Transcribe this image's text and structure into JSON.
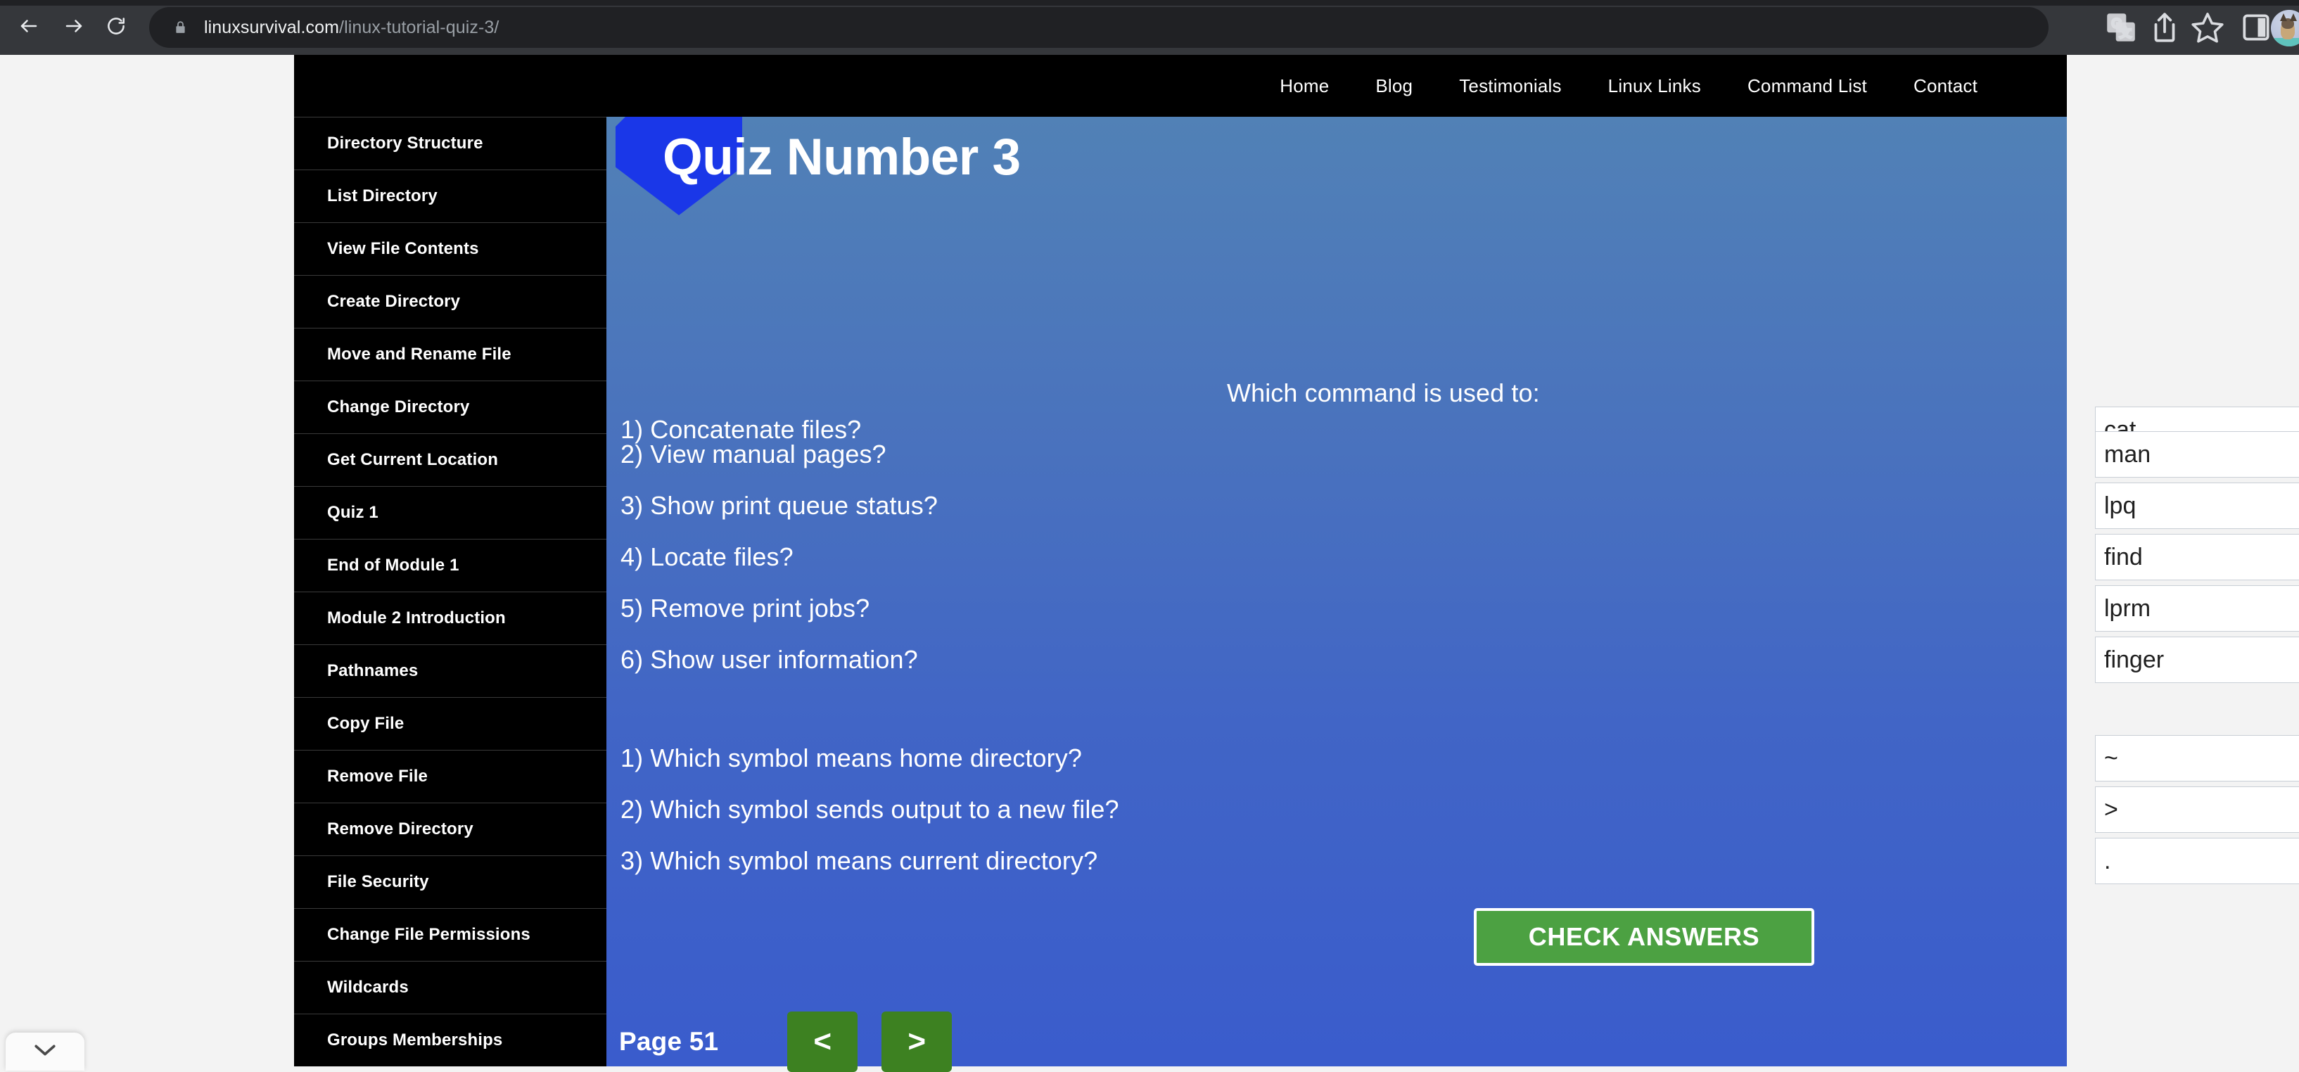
{
  "browser": {
    "back_icon": "back-arrow-icon",
    "forward_icon": "forward-arrow-icon",
    "reload_icon": "reload-icon",
    "lock_icon": "lock-icon",
    "url_domain": "linuxsurvival.com",
    "url_path": "/linux-tutorial-quiz-3/",
    "actions": [
      {
        "name": "translate-icon",
        "label": "Translate"
      },
      {
        "name": "share-icon",
        "label": "Share"
      },
      {
        "name": "bookmark-star-icon",
        "label": "Bookmark"
      },
      {
        "name": "side-panel-icon",
        "label": "Side panel"
      }
    ],
    "avatar_name": "profile-avatar",
    "downloads_chevron": "chevron-down-icon"
  },
  "site_nav": {
    "items": [
      {
        "label": "Home"
      },
      {
        "label": "Blog"
      },
      {
        "label": "Testimonials"
      },
      {
        "label": "Linux Links"
      },
      {
        "label": "Command List"
      },
      {
        "label": "Contact"
      }
    ]
  },
  "sidebar": {
    "items": [
      {
        "label": "Directory Structure"
      },
      {
        "label": "List Directory"
      },
      {
        "label": "View File Contents"
      },
      {
        "label": "Create Directory"
      },
      {
        "label": "Move and Rename File"
      },
      {
        "label": "Change Directory"
      },
      {
        "label": "Get Current Location"
      },
      {
        "label": "Quiz 1"
      },
      {
        "label": "End of Module 1"
      },
      {
        "label": "Module 2 Introduction"
      },
      {
        "label": "Pathnames"
      },
      {
        "label": "Copy File"
      },
      {
        "label": "Remove File"
      },
      {
        "label": "Remove Directory"
      },
      {
        "label": "File Security"
      },
      {
        "label": "Change File Permissions"
      },
      {
        "label": "Wildcards"
      },
      {
        "label": "Groups Memberships"
      }
    ]
  },
  "quiz": {
    "title": "Quiz Number 3",
    "prompt": "Which command is used to:",
    "section_one": [
      {
        "question": "1) Concatenate files?",
        "answer": "cat",
        "status": "correct"
      },
      {
        "question": "2) View manual pages?",
        "answer": "man",
        "status": "correct"
      },
      {
        "question": "3) Show print queue status?",
        "answer": "lpq",
        "status": "correct"
      },
      {
        "question": "4) Locate files?",
        "answer": "find",
        "status": "correct"
      },
      {
        "question": "5) Remove print jobs?",
        "answer": "lprm",
        "status": "correct"
      },
      {
        "question": "6) Show user information?",
        "answer": "finger",
        "status": "correct"
      }
    ],
    "section_two": [
      {
        "question": "1) Which symbol means home directory?",
        "answer": "~",
        "status": "correct"
      },
      {
        "question": "2) Which symbol sends output to a new file?",
        "answer": ">",
        "status": "correct"
      },
      {
        "question": "3) Which symbol means current directory?",
        "answer": ".",
        "status": "correct"
      }
    ],
    "check_button_label": "CHECK ANSWERS",
    "page_label": "Page 51",
    "prev_label": "<",
    "next_label": ">",
    "colors": {
      "panel_top": "#5181b6",
      "panel_bottom": "#3a5ccc",
      "diamond": "#1a37e8",
      "check_mark": "#7ace3e",
      "check_button": "#4ca142",
      "page_nav_button": "#3d8121",
      "sidebar": "#000000"
    }
  }
}
